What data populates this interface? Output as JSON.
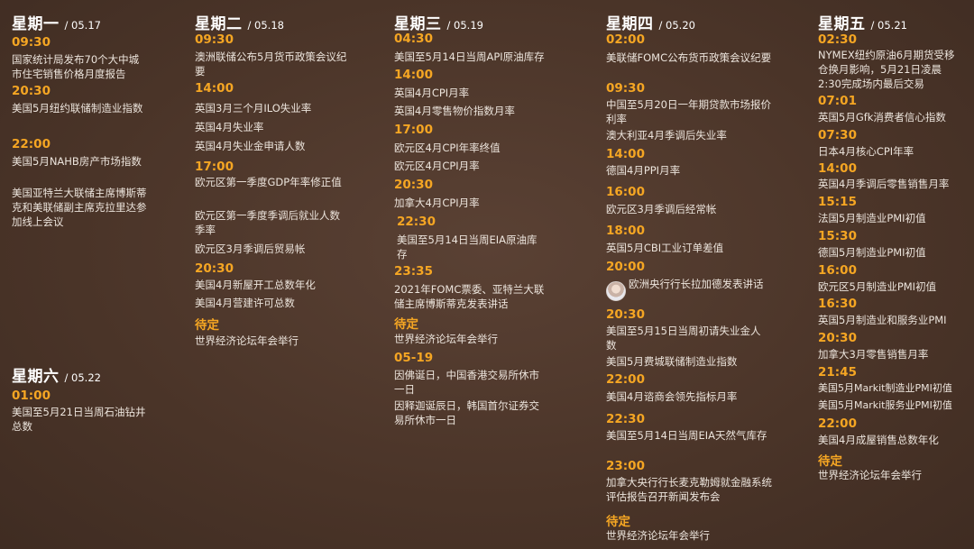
{
  "colors": {
    "background": "#4d372c",
    "time": "#f5a623",
    "text": "#ece4dc",
    "heading": "#ffffff"
  },
  "days": [
    {
      "day": "星期一",
      "date": "/ 05.17",
      "slots": [
        {
          "time": "09:30",
          "events": [
            "国家统计局发布70个大中城市住宅销售价格月度报告"
          ]
        },
        {
          "time": "20:30",
          "events": [
            "美国5月纽约联储制造业指数"
          ]
        },
        {
          "time": "22:00",
          "events": [
            "美国5月NAHB房产市场指数",
            "美国亚特兰大联储主席博斯蒂克和美联储副主席克拉里达参加线上会议"
          ]
        }
      ]
    },
    {
      "day": "星期二",
      "date": "/ 05.18",
      "slots": [
        {
          "time": "09:30",
          "events": [
            "澳洲联储公布5月货币政策会议纪要"
          ]
        },
        {
          "time": "14:00",
          "events": [
            "英国3月三个月ILO失业率",
            "英国4月失业率",
            "英国4月失业金申请人数"
          ]
        },
        {
          "time": "17:00",
          "events": [
            "欧元区第一季度GDP年率修正值",
            "欧元区第一季度季调后就业人数季率",
            "欧元区3月季调后贸易帐"
          ]
        },
        {
          "time": "20:30",
          "events": [
            "美国4月新屋开工总数年化",
            "美国4月营建许可总数"
          ]
        },
        {
          "time": "待定",
          "events": [
            "世界经济论坛年会举行"
          ]
        }
      ]
    },
    {
      "day": "星期三",
      "date": "/ 05.19",
      "slots": [
        {
          "time": "04:30",
          "events": [
            "美国至5月14日当周API原油库存"
          ]
        },
        {
          "time": "14:00",
          "events": [
            "英国4月CPI月率",
            "英国4月零售物价指数月率"
          ]
        },
        {
          "time": "17:00",
          "events": [
            "欧元区4月CPI年率终值",
            "欧元区4月CPI月率"
          ]
        },
        {
          "time": "20:30",
          "events": [
            "加拿大4月CPI月率"
          ]
        },
        {
          "time": "22:30",
          "events": [
            "美国至5月14日当周EIA原油库存"
          ]
        },
        {
          "time": "23:35",
          "events": [
            "2021年FOMC票委、亚特兰大联储主席博斯蒂克发表讲话"
          ]
        },
        {
          "time": "待定",
          "events": [
            "世界经济论坛年会举行"
          ]
        },
        {
          "time": "05-19",
          "events": [
            "因佛诞日，中国香港交易所休市一日",
            "因释迦诞辰日，韩国首尔证券交易所休市一日"
          ]
        }
      ]
    },
    {
      "day": "星期四",
      "date": "/ 05.20",
      "slots": [
        {
          "time": "02:00",
          "events": [
            "美联储FOMC公布货币政策会议纪要"
          ]
        },
        {
          "time": "09:30",
          "events": [
            "中国至5月20日一年期贷款市场报价利率",
            "澳大利亚4月季调后失业率"
          ]
        },
        {
          "time": "14:00",
          "events": [
            "德国4月PPI月率"
          ]
        },
        {
          "time": "16:00",
          "events": [
            "欧元区3月季调后经常帐"
          ]
        },
        {
          "time": "18:00",
          "events": [
            "英国5月CBI工业订单差值"
          ]
        },
        {
          "time": "20:00",
          "events": [
            "欧洲央行行长拉加德发表讲话"
          ]
        },
        {
          "time": "20:30",
          "events": [
            "美国至5月15日当周初请失业金人数",
            "美国5月费城联储制造业指数"
          ]
        },
        {
          "time": "22:00",
          "events": [
            "美国4月谘商会领先指标月率"
          ]
        },
        {
          "time": "22:30",
          "events": [
            "美国至5月14日当周EIA天然气库存"
          ]
        },
        {
          "time": "23:00",
          "events": [
            "加拿大央行行长麦克勒姆就金融系统评估报告召开新闻发布会"
          ]
        },
        {
          "time": "待定",
          "events": [
            "世界经济论坛年会举行"
          ]
        }
      ]
    },
    {
      "day": "星期五",
      "date": "/ 05.21",
      "slots": [
        {
          "time": "02:30",
          "events": [
            "NYMEX纽约原油6月期货受移仓换月影响，5月21日凌晨2:30完成场内最后交易"
          ]
        },
        {
          "time": "07:01",
          "events": [
            "英国5月Gfk消费者信心指数"
          ]
        },
        {
          "time": "07:30",
          "events": [
            "日本4月核心CPI年率"
          ]
        },
        {
          "time": "14:00",
          "events": [
            "英国4月季调后零售销售月率"
          ]
        },
        {
          "time": "15:15",
          "events": [
            "法国5月制造业PMI初值"
          ]
        },
        {
          "time": "15:30",
          "events": [
            "德国5月制造业PMI初值"
          ]
        },
        {
          "time": "16:00",
          "events": [
            "欧元区5月制造业PMI初值"
          ]
        },
        {
          "time": "16:30",
          "events": [
            "英国5月制造业和服务业PMI"
          ]
        },
        {
          "time": "20:30",
          "events": [
            "加拿大3月零售销售月率"
          ]
        },
        {
          "time": "21:45",
          "events": [
            "美国5月Markit制造业PMI初值",
            "美国5月Markit服务业PMI初值"
          ]
        },
        {
          "time": "22:00",
          "events": [
            "美国4月成屋销售总数年化"
          ]
        },
        {
          "time": "待定",
          "events": [
            "世界经济论坛年会举行"
          ]
        }
      ]
    },
    {
      "day": "星期六",
      "date": "/ 05.22",
      "slots": [
        {
          "time": "01:00",
          "events": [
            "美国至5月21日当周石油钻井总数"
          ]
        }
      ]
    }
  ]
}
